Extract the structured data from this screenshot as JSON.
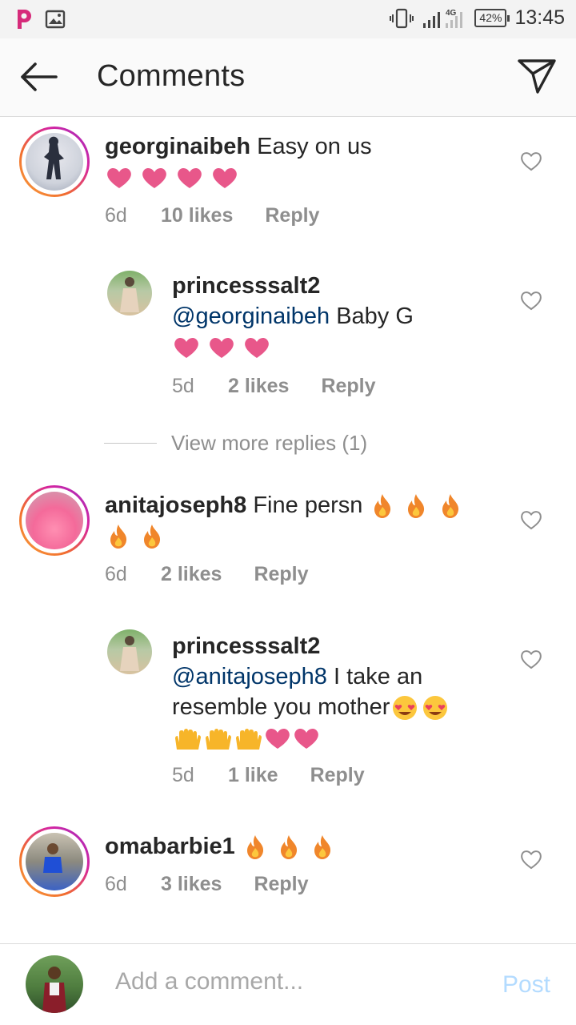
{
  "status_bar": {
    "time": "13:45",
    "battery": "42%",
    "network": "4G",
    "icons": [
      "pocket-app-icon",
      "gallery-icon",
      "vibrate-icon",
      "signal-icon",
      "battery-icon"
    ]
  },
  "header": {
    "title": "Comments",
    "icons": [
      "back-arrow-icon",
      "direct-send-icon"
    ]
  },
  "comments": [
    {
      "username": "georginaibeh",
      "text": "Easy on us",
      "emoji": [
        "heart",
        "heart",
        "heart",
        "heart"
      ],
      "time": "6d",
      "likes": "10 likes",
      "reply": "Reply"
    },
    {
      "username": "princesssalt2",
      "mention": "@georginaibeh",
      "text": " Baby G",
      "emoji": [
        "heart",
        "heart",
        "heart"
      ],
      "time": "5d",
      "likes": "2 likes",
      "reply": "Reply",
      "is_reply": true
    },
    {
      "username": "anitajoseph8",
      "text": "Fine persn",
      "emoji": [
        "fire",
        "fire",
        "fire",
        "fire",
        "fire"
      ],
      "time": "6d",
      "likes": "2 likes",
      "reply": "Reply"
    },
    {
      "username": "princesssalt2",
      "mention": "@anitajoseph8",
      "text": " I take an resemble you mother",
      "emoji": [
        "heart-eyes",
        "heart-eyes",
        "raised-hands",
        "raised-hands",
        "raised-hands",
        "heart",
        "heart"
      ],
      "time": "5d",
      "likes": "1 like",
      "reply": "Reply",
      "is_reply": true
    },
    {
      "username": "omabarbie1",
      "text": "",
      "emoji": [
        "fire",
        "fire",
        "fire"
      ],
      "time": "6d",
      "likes": "3 likes",
      "reply": "Reply"
    }
  ],
  "view_more_replies": "View more replies (1)",
  "composer": {
    "placeholder": "Add a comment...",
    "post_label": "Post"
  },
  "colors": {
    "mention": "#003569",
    "meta_gray": "#8e8e8e",
    "post_disabled": "#b3dbff",
    "heart_emoji": "#e8578a"
  }
}
